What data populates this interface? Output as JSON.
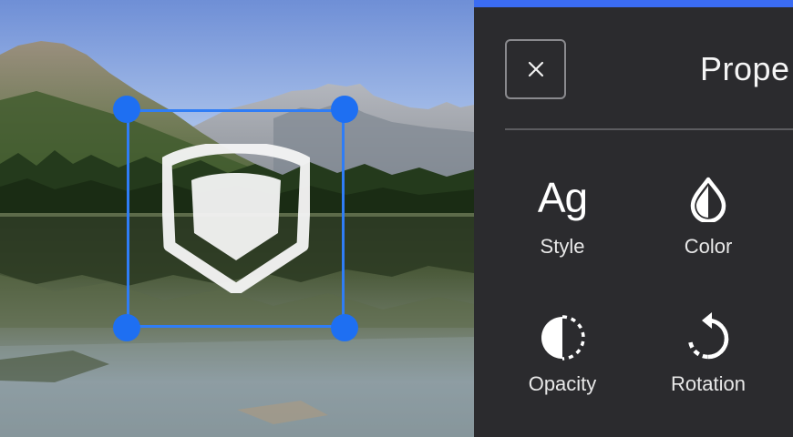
{
  "panel": {
    "title": "Prope",
    "close_icon": "close-icon",
    "tools": [
      {
        "label": "Style",
        "icon": "text-style-icon",
        "glyph": "Ag"
      },
      {
        "label": "Color",
        "icon": "color-drop-icon"
      },
      {
        "label": "Opacity",
        "icon": "opacity-icon"
      },
      {
        "label": "Rotation",
        "icon": "rotation-icon"
      }
    ]
  },
  "canvas": {
    "sticker_icon": "shield-sticker",
    "selection_handles": [
      "top-left",
      "top-right",
      "bottom-left",
      "bottom-right"
    ]
  },
  "colors": {
    "accent": "#3b6cf3",
    "selection": "#2f7df6",
    "panel_bg": "#2b2b2e",
    "text": "#f2f2f2"
  }
}
